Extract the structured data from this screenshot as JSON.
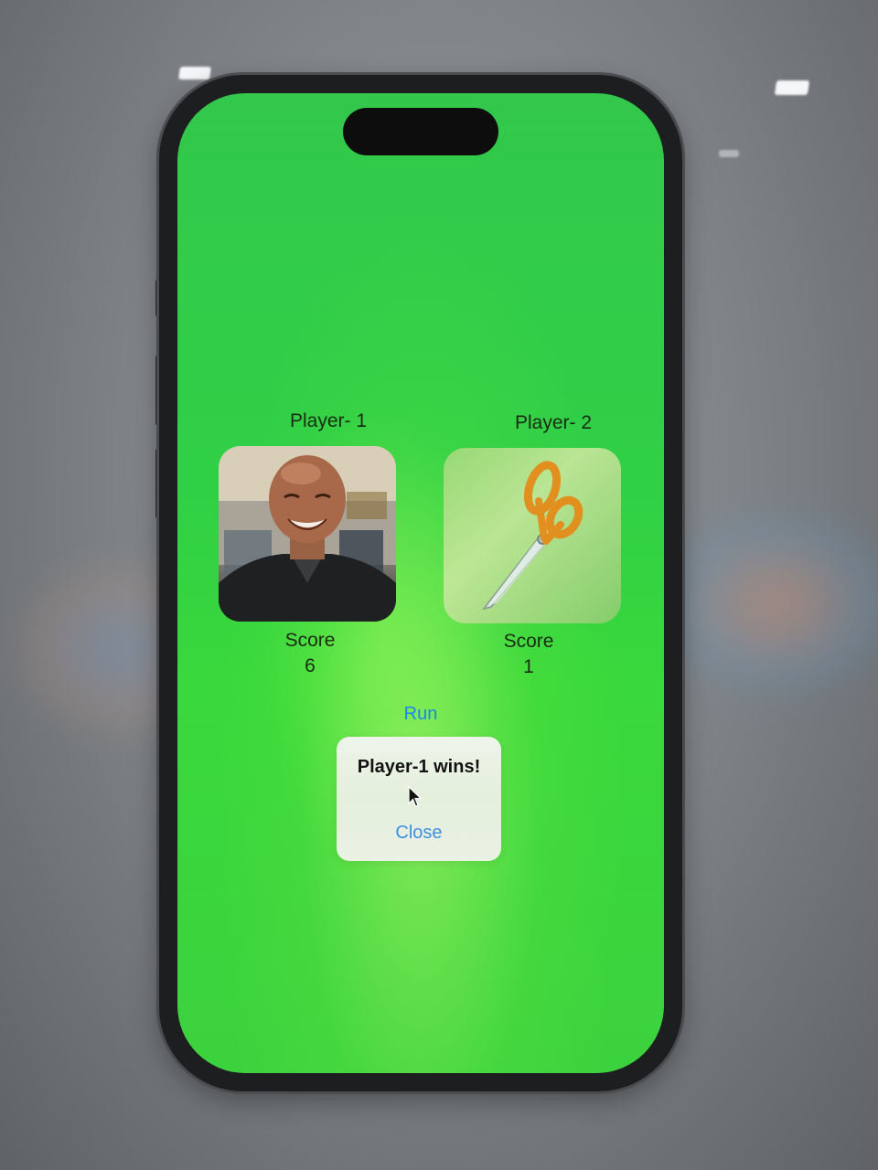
{
  "players": [
    {
      "label": "Player- 1",
      "choice_image": "person-photo",
      "score_label": "Score",
      "score": "6"
    },
    {
      "label": "Player- 2",
      "choice_image": "scissors",
      "score_label": "Score",
      "score": "1"
    }
  ],
  "run_label": "Run",
  "alert": {
    "title": "Player-1 wins!",
    "close_label": "Close"
  },
  "colors": {
    "screen_background": "#33cc44",
    "link_blue": "#1d86e8",
    "scissors_orange": "#f08a1c"
  },
  "icons": [
    "person-photo",
    "scissors-icon",
    "mouse-cursor-icon"
  ]
}
